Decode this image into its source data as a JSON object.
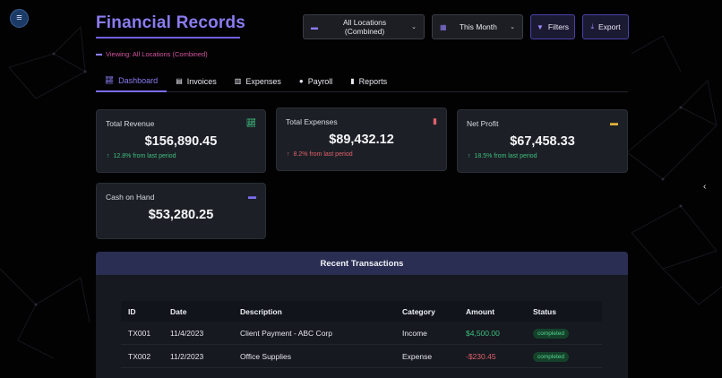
{
  "header": {
    "title": "Financial Records",
    "location_select": "All Locations (Combined)",
    "period_select": "This Month",
    "filters_label": "Filters",
    "export_label": "Export",
    "viewing_text": "Viewing: All Locations (Combined)"
  },
  "tabs": [
    {
      "label": "Dashboard",
      "icon": "chart-icon",
      "active": true
    },
    {
      "label": "Invoices",
      "icon": "invoice-icon",
      "active": false
    },
    {
      "label": "Expenses",
      "icon": "receipt-icon",
      "active": false
    },
    {
      "label": "Payroll",
      "icon": "user-icon",
      "active": false
    },
    {
      "label": "Reports",
      "icon": "bar-chart-icon",
      "active": false
    }
  ],
  "cards": {
    "revenue": {
      "label": "Total Revenue",
      "value": "$156,890.45",
      "change": "12.8% from last period",
      "trend": "up",
      "icon": "trend-up-icon"
    },
    "expenses": {
      "label": "Total Expenses",
      "value": "$89,432.12",
      "change": "8.2% from last period",
      "trend": "up",
      "icon": "receipt-icon"
    },
    "profit": {
      "label": "Net Profit",
      "value": "$67,458.33",
      "change": "18.5% from last period",
      "trend": "up",
      "icon": "money-icon"
    },
    "cash": {
      "label": "Cash on Hand",
      "value": "$53,280.25",
      "icon": "cash-icon"
    }
  },
  "transactions": {
    "title": "Recent Transactions",
    "columns": [
      "ID",
      "Date",
      "Description",
      "Category",
      "Amount",
      "Status"
    ],
    "rows": [
      {
        "id": "TX001",
        "date": "11/4/2023",
        "description": "Client Payment - ABC Corp",
        "category": "Income",
        "amount": "$4,500.00",
        "status": "completed"
      },
      {
        "id": "TX002",
        "date": "11/2/2023",
        "description": "Office Supplies",
        "category": "Expense",
        "amount": "-$230.45",
        "status": "completed"
      }
    ]
  },
  "colors": {
    "accent": "#8a7cf0",
    "positive": "#3fbf7f",
    "negative": "#e0606b",
    "card_bg": "#1c2026"
  }
}
